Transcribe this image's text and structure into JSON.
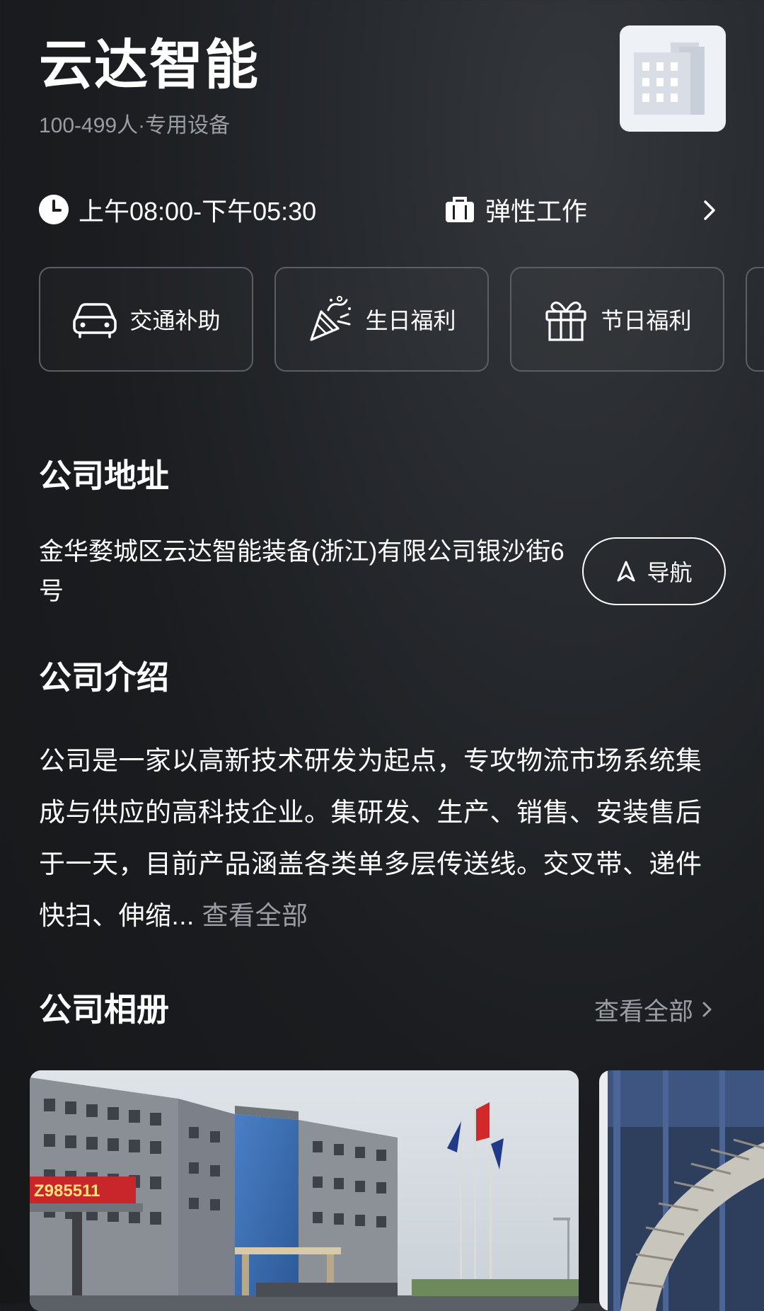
{
  "company": {
    "name": "云达智能",
    "meta": "100-499人·专用设备"
  },
  "work": {
    "hours": "上午08:00-下午05:30",
    "schedule": "弹性工作"
  },
  "benefits": [
    {
      "label": "交通补助",
      "icon": "car-icon"
    },
    {
      "label": "生日福利",
      "icon": "party-popper-icon"
    },
    {
      "label": "节日福利",
      "icon": "gift-icon"
    }
  ],
  "address": {
    "title": "公司地址",
    "text": "金华婺城区云达智能装备(浙江)有限公司银沙街6号",
    "nav_label": "导航"
  },
  "intro": {
    "title": "公司介绍",
    "text": "公司是一家以高新技术研发为起点，专攻物流市场系统集成与供应的高科技企业。集研发、生产、销售、安装售后于一天，目前产品涵盖各类单多层传送线。交叉带、递件快扫、伸缩...",
    "more": "查看全部"
  },
  "album": {
    "title": "公司相册",
    "more": "查看全部",
    "sign_text": "Z985511"
  },
  "colors": {
    "background": "#1a1c1f",
    "text": "#ffffff",
    "muted": "#9a9da2",
    "border": "#5b5e63"
  }
}
